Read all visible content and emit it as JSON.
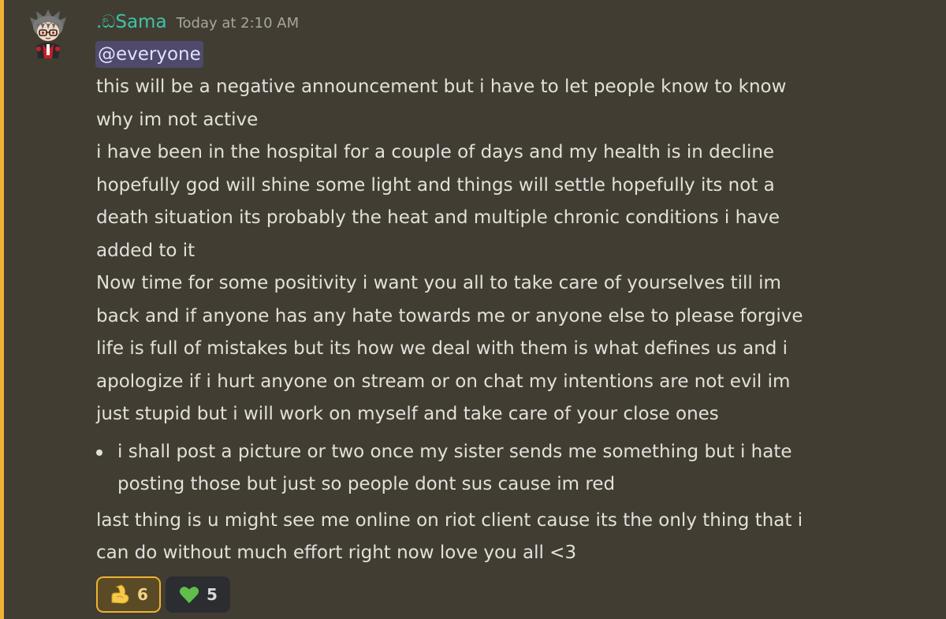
{
  "message": {
    "author": {
      "display_name": ".ඞSama",
      "avatar_icon": "chibi-character-avatar",
      "name_color": "#3ec4a6"
    },
    "timestamp": "Today at 2:10 AM",
    "mention": "@everyone",
    "lines": [
      "this will be a negative announcement but i have to let people know to know",
      "why im not active",
      "i have been in the hospital for a couple of days and my health is in decline",
      "hopefully god will shine some light and things will settle hopefully its not a",
      "death situation its probably the heat and multiple chronic conditions i have",
      "added to it",
      "Now time for some positivity i want you all to take care of yourselves till im",
      "back and if anyone has any hate towards me or anyone else to please forgive",
      "life is full of mistakes but its how we deal with them is what defines us and i",
      "apologize if i hurt anyone on stream or on chat my intentions are not evil im",
      "just stupid but i will work on myself and take care of your close ones"
    ],
    "bullet_lines": [
      "i shall post a picture or two once my sister sends me something but i hate",
      "posting those but just so people dont sus cause im red"
    ],
    "closing_lines": [
      "last thing is u might see me online on riot client cause its the only thing that i",
      "can do without much effort right now love you all <3"
    ],
    "reactions": [
      {
        "emoji": "flexed-biceps-icon",
        "count": "6",
        "active": true
      },
      {
        "emoji": "green-heart-icon",
        "count": "5",
        "active": false
      }
    ]
  },
  "colors": {
    "background": "#423d33",
    "mention_highlight_bar": "#f0b232",
    "mention_pill": "#4f4a6b",
    "text": "#e2e0db",
    "timestamp": "#a8a69f"
  }
}
